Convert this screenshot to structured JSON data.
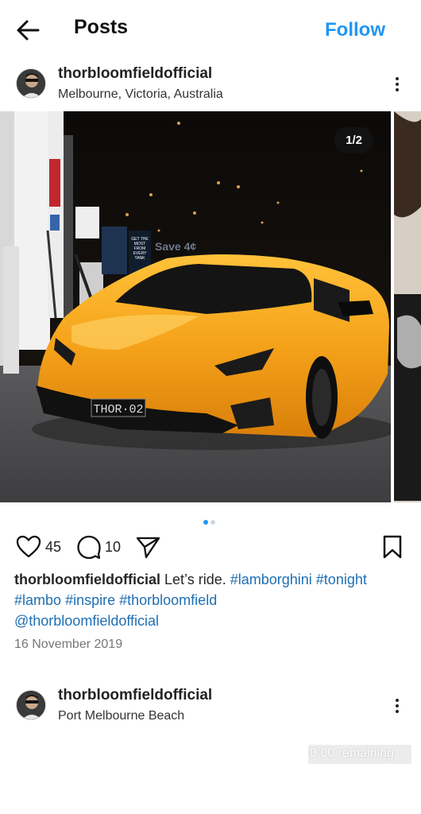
{
  "header": {
    "title": "Posts",
    "follow_label": "Follow"
  },
  "post": {
    "username": "thorbloomfieldofficial",
    "location": "Melbourne, Victoria, Australia",
    "media": {
      "counter": "1/2",
      "plate_text": "THOR · 02",
      "sign_text": "Save 4¢",
      "sign_text2": "GET THE MOST FROM EVERY TANK"
    },
    "likes": "45",
    "comments": "10",
    "caption": {
      "user": "thorbloomfieldofficial",
      "text": " Let’s ride. ",
      "tags": [
        "#lamborghini",
        "#tonight",
        "#lambo",
        "#inspire",
        "#thorbloomfield",
        "@thorbloomfieldofficial"
      ]
    },
    "date": "16 November 2019"
  },
  "next_post": {
    "username": "thorbloomfieldofficial",
    "location": "Port Melbourne Beach"
  },
  "overlay": {
    "remaining": "0:00 remaining"
  },
  "colors": {
    "accent": "#2196f3",
    "hashtag": "#1f6fb2",
    "car": "#f5a21a"
  }
}
